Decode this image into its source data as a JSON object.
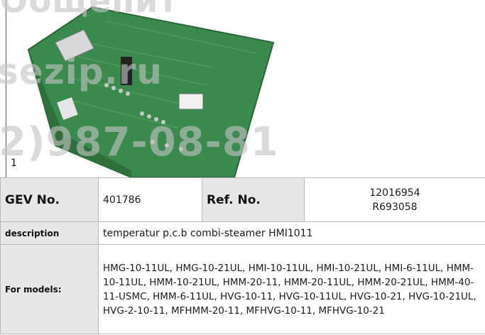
{
  "figure": {
    "number": "1"
  },
  "watermark": {
    "line1": "Общепит",
    "line2": "sezip.ru",
    "line3": "2)987-08-81"
  },
  "spec": {
    "gev_label": "GEV No.",
    "gev_value": "401786",
    "ref_label": "Ref. No.",
    "ref_values": [
      "12016954",
      "R693058"
    ],
    "description_label": "description",
    "description_value": "temperatur p.c.b  combi-steamer HMI1011",
    "models_label": "For models:",
    "models_value": "HMG-10-11UL, HMG-10-21UL, HMI-10-11UL, HMI-10-21UL, HMI-6-11UL, HMM-10-11UL, HMM-10-21UL, HMM-20-11, HMM-20-11UL, HMM-20-21UL, HMM-40-11-USMC, HMM-6-11UL, HVG-10-11, HVG-10-11UL, HVG-10-21, HVG-10-21UL, HVG-2-10-11, MFHMM-20-11, MFHVG-10-11, MFHVG-10-21"
  }
}
